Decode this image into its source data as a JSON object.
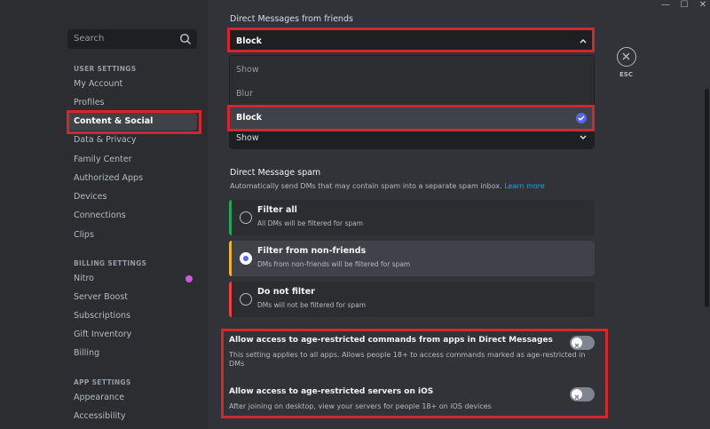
{
  "window_controls": {
    "minimize": "—",
    "maximize": "☐",
    "close": "✕"
  },
  "sidebar": {
    "search_placeholder": "Search",
    "sections": [
      {
        "title": "USER SETTINGS"
      },
      {
        "title": "BILLING SETTINGS"
      },
      {
        "title": "APP SETTINGS"
      }
    ],
    "items": [
      {
        "label": "My Account"
      },
      {
        "label": "Profiles"
      },
      {
        "label": "Content & Social"
      },
      {
        "label": "Data & Privacy"
      },
      {
        "label": "Family Center"
      },
      {
        "label": "Authorized Apps"
      },
      {
        "label": "Devices"
      },
      {
        "label": "Connections"
      },
      {
        "label": "Clips"
      },
      {
        "label": "Nitro"
      },
      {
        "label": "Server Boost"
      },
      {
        "label": "Subscriptions"
      },
      {
        "label": "Gift Inventory"
      },
      {
        "label": "Billing"
      },
      {
        "label": "Appearance"
      },
      {
        "label": "Accessibility"
      }
    ],
    "active_item": "Content & Social"
  },
  "dm_friends": {
    "label": "Direct Messages from friends",
    "value": "Block",
    "options": [
      "Show",
      "Blur",
      "Block"
    ],
    "selected": "Block"
  },
  "second_dropdown": {
    "value": "Show"
  },
  "esc": {
    "label": "ESC"
  },
  "dm_spam": {
    "heading": "Direct Message spam",
    "description": "Automatically send DMs that may contain spam into a separate spam inbox.",
    "learn_more": "Learn more",
    "options": [
      {
        "title": "Filter all",
        "desc": "All DMs will be filtered for spam",
        "color": "#23a55a"
      },
      {
        "title": "Filter from non-friends",
        "desc": "DMs from non-friends will be filtered for spam",
        "color": "#f0b232"
      },
      {
        "title": "Do not filter",
        "desc": "DMs will not be filtered for spam",
        "color": "#f23f43"
      }
    ],
    "selected": "Filter from non-friends"
  },
  "age_restricted": {
    "commands": {
      "title": "Allow access to age-restricted commands from apps in Direct Messages",
      "desc_line1": "This setting applies to all apps. Allows people 18+ to access commands marked as age-restricted in",
      "desc_line2": "DMs",
      "enabled": false
    },
    "servers": {
      "title": "Allow access to age-restricted servers on iOS",
      "desc": "After joining on desktop, view your servers for people 18+ on iOS devices",
      "enabled": false
    }
  },
  "colors": {
    "accent": "#5865f2",
    "highlight": "#d4262b"
  }
}
